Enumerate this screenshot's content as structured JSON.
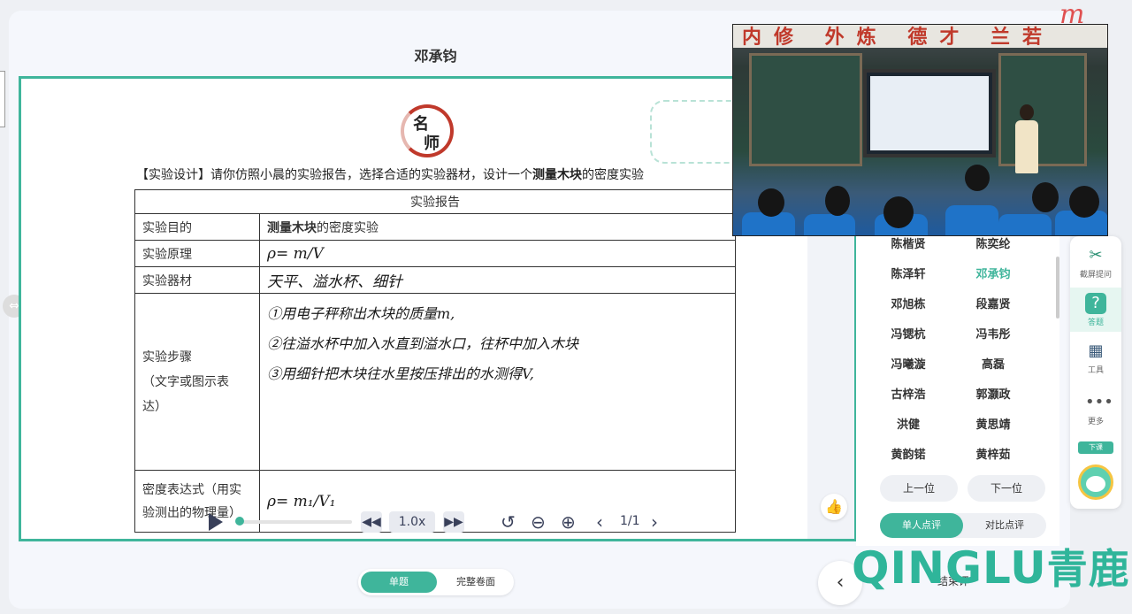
{
  "modal": {
    "title": "邓承钧"
  },
  "logo": {
    "line1": "名",
    "line2": "师"
  },
  "question": {
    "prefix": "【实验设计】请你仿照小晨的实验报告，选择合适的实验器材，设计一个",
    "bold": "测量木块",
    "suffix": "的密度实验"
  },
  "report": {
    "header": "实验报告",
    "rows": [
      {
        "label": "实验目的",
        "bold": "测量木块",
        "text": "的密度实验"
      },
      {
        "label": "实验原理",
        "hand": "ρ= m/V"
      },
      {
        "label": "实验器材",
        "hand": "天平、溢水杯、细针"
      },
      {
        "label_line1": "实验步骤",
        "label_line2": "（文字或图示表",
        "label_line3": "达）",
        "hand1": "①用电子秤称出木块的质量m,",
        "hand2": "②往溢水杯中加入水直到溢水口，往杯中加入木块",
        "hand3": "③用细针把木块往水里按压排出的水测得V,"
      },
      {
        "label_line1": "密度表达式（用实",
        "label_line2": "验测出的物理量）",
        "hand": "ρ= m₁/V₁"
      }
    ]
  },
  "player": {
    "speed": "1.0x",
    "pages": "1/1",
    "progress": 0.02
  },
  "bottom_tabs": {
    "active": "单题",
    "inactive": "完整卷面"
  },
  "camera": {
    "banner": "内修 外炼 德才 兰若"
  },
  "students": [
    {
      "name": "陈楷贤",
      "selected": false
    },
    {
      "name": "陈奕纶",
      "selected": false
    },
    {
      "name": "陈泽轩",
      "selected": false
    },
    {
      "name": "邓承钧",
      "selected": true
    },
    {
      "name": "邓旭栋",
      "selected": false
    },
    {
      "name": "段嘉贤",
      "selected": false
    },
    {
      "name": "冯锶杭",
      "selected": false
    },
    {
      "name": "冯韦彤",
      "selected": false
    },
    {
      "name": "冯曦漩",
      "selected": false
    },
    {
      "name": "高磊",
      "selected": false
    },
    {
      "name": "古梓浩",
      "selected": false
    },
    {
      "name": "郭灏政",
      "selected": false
    },
    {
      "name": "洪健",
      "selected": false
    },
    {
      "name": "黄思靖",
      "selected": false
    },
    {
      "name": "黄韵锘",
      "selected": false
    },
    {
      "name": "黄梓茹",
      "selected": false
    }
  ],
  "nav": {
    "prev": "上一位",
    "next": "下一位"
  },
  "review": {
    "active": "单人点评",
    "inactive": "对比点评"
  },
  "toolbar": [
    {
      "label": "截屏提问",
      "icon": "scissors-icon"
    },
    {
      "label": "答题",
      "icon": "question-icon"
    },
    {
      "label": "工具",
      "icon": "toolbox-icon"
    },
    {
      "label": "更多",
      "icon": "more-icon"
    }
  ],
  "exit": "下课",
  "watermark": {
    "latin": "QINGLU",
    "cn": "青鹿"
  },
  "corner_mark": "m",
  "under_text": "结束评"
}
